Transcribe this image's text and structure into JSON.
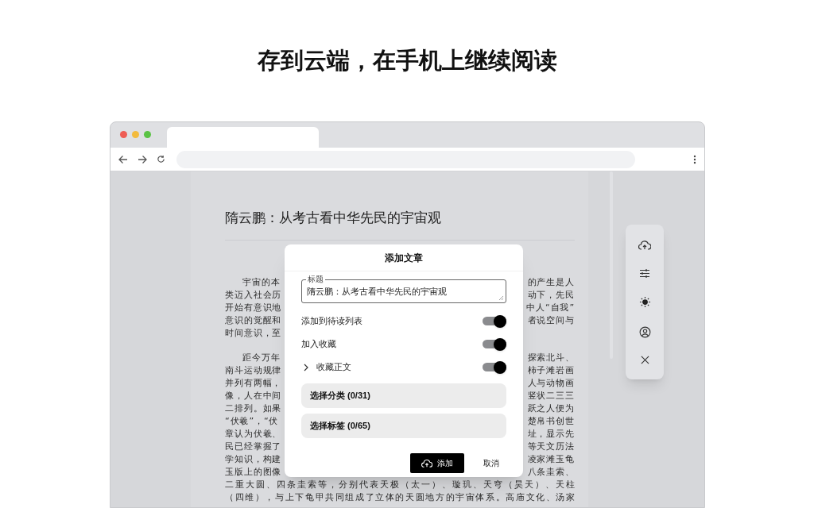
{
  "headline": "存到云端，在手机上继续阅读",
  "article": {
    "title": "隋云鹏：从考古看中华先民的宇宙观",
    "paragraphs": [
      {
        "lines": [
          {
            "left": "宇宙的本",
            "right": "的产生是人"
          },
          {
            "left": "类迈入社会历",
            "right": "动下，先民"
          },
          {
            "left": "开始有意识地",
            "right": "中人“自我”"
          },
          {
            "left": "意识的觉醒和",
            "right": "者说空间与"
          },
          {
            "left": "时间意识，至"
          }
        ]
      },
      {
        "lines": [
          {
            "left": "距今万年",
            "right": "探索北斗、"
          },
          {
            "left": "南斗运动规律",
            "right": "柿子滩岩画"
          },
          {
            "left": "并列有两幅，",
            "right": "人与动物画"
          },
          {
            "left": "像，人在中间",
            "right": "竖状二三三"
          },
          {
            "left": "二排列。如果",
            "right": "跃之人便为"
          },
          {
            "left": "“伏羲”，“伏",
            "right": "楚帛书创世"
          },
          {
            "left": "章认为伏羲、",
            "right": "址，显示先"
          },
          {
            "left": "民已经掌握了",
            "right": "等天文历法"
          },
          {
            "left": "学知识，构建",
            "right": "凌家滩玉龟"
          },
          {
            "left": "玉版上的图像",
            "right": "八条圭索、"
          },
          {
            "left": "二重大圆、四条圭索等，分别代表天极（太一）、璇玑、天穹（昊天）、天柱"
          },
          {
            "left": "（四维），与上下龟甲共同组成了立体的天圆地方的宇宙体系。高庙文化、汤家"
          }
        ]
      }
    ]
  },
  "dialog": {
    "title": "添加文章",
    "field": {
      "label": "标题",
      "value": "隋云鹏：从考古看中华先民的宇宙观"
    },
    "options": [
      {
        "kind": "switch",
        "label": "添加到待读列表",
        "on": true
      },
      {
        "kind": "switch",
        "label": "加入收藏",
        "on": true
      },
      {
        "kind": "expandable",
        "label": "收藏正文",
        "on": true,
        "expanded": false
      }
    ],
    "pickers": [
      "选择分类 (0/31)",
      "选择标签 (0/65)"
    ],
    "primary": "添加",
    "secondary": "取消"
  }
}
